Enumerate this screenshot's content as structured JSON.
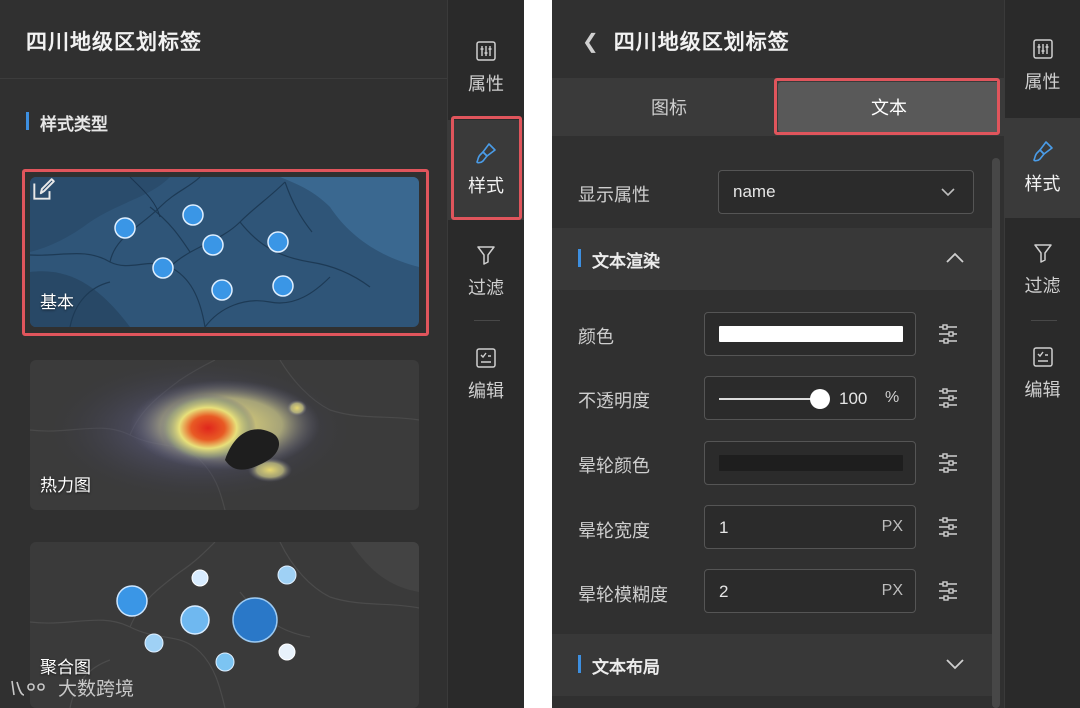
{
  "left_panel": {
    "title": "四川地级区划标签",
    "section_label": "样式类型",
    "cards": [
      {
        "label": "基本",
        "selected": true
      },
      {
        "label": "热力图",
        "selected": false
      },
      {
        "label": "聚合图",
        "selected": false
      }
    ],
    "sidebar": [
      {
        "label": "属性",
        "icon": "sliders-icon"
      },
      {
        "label": "样式",
        "icon": "brush-icon",
        "active": true
      },
      {
        "label": "过滤",
        "icon": "filter-icon"
      },
      {
        "label": "编辑",
        "icon": "edit-list-icon"
      }
    ],
    "watermark": "大数跨境"
  },
  "right_panel": {
    "title": "四川地级区划标签",
    "tabs": [
      {
        "label": "图标",
        "active": false
      },
      {
        "label": "文本",
        "active": true
      }
    ],
    "display_attr": {
      "label": "显示属性",
      "value": "name"
    },
    "group_render": {
      "title": "文本渲染",
      "expanded": true
    },
    "fields": {
      "color": {
        "label": "颜色",
        "value": "#ffffff"
      },
      "opacity": {
        "label": "不透明度",
        "value": 100,
        "value_text": "100",
        "unit": "%"
      },
      "halo_color": {
        "label": "晕轮颜色",
        "value": "#1e1e1e"
      },
      "halo_width": {
        "label": "晕轮宽度",
        "value": "1",
        "unit": "PX"
      },
      "halo_blur": {
        "label": "晕轮模糊度",
        "value": "2",
        "unit": "PX"
      }
    },
    "group_layout": {
      "title": "文本布局",
      "expanded": false
    },
    "sidebar": [
      {
        "label": "属性",
        "icon": "sliders-icon"
      },
      {
        "label": "样式",
        "icon": "brush-icon",
        "active": true
      },
      {
        "label": "过滤",
        "icon": "filter-icon"
      },
      {
        "label": "编辑",
        "icon": "edit-list-icon"
      }
    ]
  },
  "colors": {
    "accent_blue": "#3d8fe0",
    "highlight_red": "#e0555c",
    "panel_bg": "#303030"
  }
}
